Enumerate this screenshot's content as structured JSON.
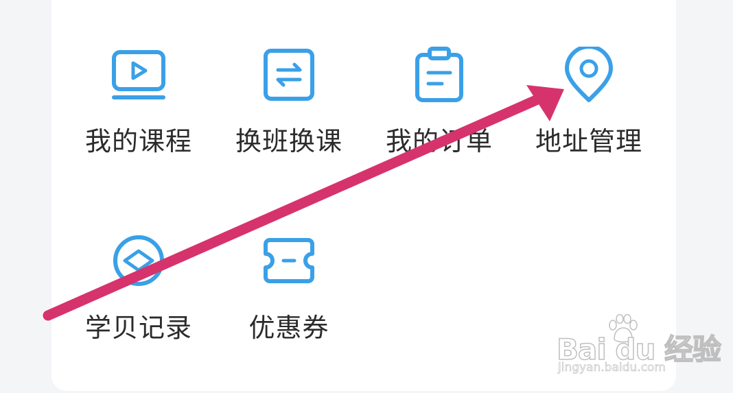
{
  "menu": {
    "items": [
      {
        "label": "我的课程",
        "icon": "video-screen-icon"
      },
      {
        "label": "换班换课",
        "icon": "swap-arrows-icon"
      },
      {
        "label": "我的订单",
        "icon": "clipboard-icon"
      },
      {
        "label": "地址管理",
        "icon": "location-pin-icon"
      },
      {
        "label": "学贝记录",
        "icon": "shell-coin-icon"
      },
      {
        "label": "优惠券",
        "icon": "ticket-icon"
      }
    ]
  },
  "watermark": {
    "brand": "Bai du 经验",
    "url": "jingyan.baidu.com"
  },
  "colors": {
    "icon": "#3aa0e8",
    "label": "#2b2b2b",
    "arrow": "#d6336c",
    "card": "#ffffff",
    "background": "#f4f5f7"
  }
}
